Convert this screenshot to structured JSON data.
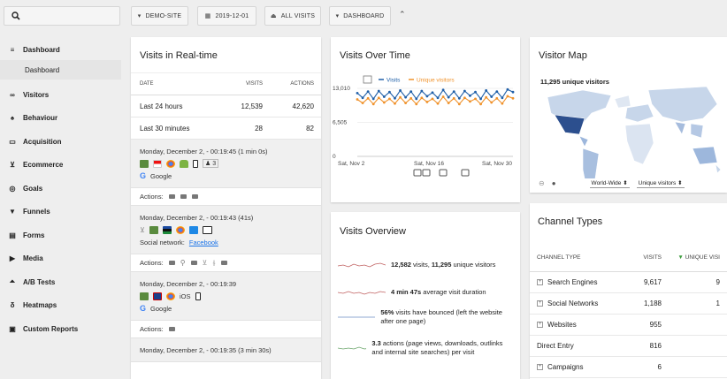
{
  "topbar": {
    "site": "DEMO-SITE",
    "date": "2019-12-01",
    "segment": "ALL VISITS",
    "view": "DASHBOARD"
  },
  "sidebar": {
    "items": [
      {
        "label": "Dashboard",
        "icon": "menu-icon"
      },
      {
        "label": "Visitors",
        "icon": "glasses-icon"
      },
      {
        "label": "Behaviour",
        "icon": "bell-icon"
      },
      {
        "label": "Acquisition",
        "icon": "briefcase-icon"
      },
      {
        "label": "Ecommerce",
        "icon": "cart-icon"
      },
      {
        "label": "Goals",
        "icon": "target-icon"
      },
      {
        "label": "Funnels",
        "icon": "funnel-icon"
      },
      {
        "label": "Forms",
        "icon": "form-icon"
      },
      {
        "label": "Media",
        "icon": "media-icon"
      },
      {
        "label": "A/B Tests",
        "icon": "flask-icon"
      },
      {
        "label": "Heatmaps",
        "icon": "flame-icon"
      },
      {
        "label": "Custom Reports",
        "icon": "report-icon"
      }
    ],
    "sub": "Dashboard"
  },
  "realtime": {
    "title": "Visits in Real-time",
    "headers": [
      "DATE",
      "VISITS",
      "ACTIONS"
    ],
    "rows": [
      {
        "label": "Last 24 hours",
        "visits": "12,539",
        "actions": "42,620"
      },
      {
        "label": "Last 30 minutes",
        "visits": "28",
        "actions": "82"
      }
    ],
    "visits": [
      {
        "time": "Monday, December 2, - 00:19:45 (1 min 0s)",
        "count": "3",
        "source": "Google",
        "actions_label": "Actions:"
      },
      {
        "time": "Monday, December 2, - 00:19:43 (41s)",
        "source_prefix": "Social network:",
        "source": "Facebook",
        "actions_label": "Actions:"
      },
      {
        "time": "Monday, December 2, - 00:19:39",
        "os": "iOS",
        "source": "Google",
        "actions_label": "Actions:"
      },
      {
        "time": "Monday, December 2, - 00:19:35 (3 min 30s)"
      }
    ]
  },
  "vot": {
    "title": "Visits Over Time",
    "legend_visits": "Visits",
    "legend_unique": "Unique visitors",
    "colors": {
      "visits": "#1f5fa8",
      "unique": "#f0922b"
    }
  },
  "chart_data": {
    "type": "line",
    "ylim": [
      0,
      13010
    ],
    "yticks": [
      "13,010",
      "6,505",
      "0"
    ],
    "xticks": [
      "Sat, Nov 2",
      "Sat, Nov 16",
      "Sat, Nov 30"
    ],
    "series": [
      {
        "name": "Visits",
        "values": [
          12100,
          11200,
          12400,
          11000,
          12500,
          11400,
          12300,
          11100,
          12600,
          11300,
          12400,
          11000,
          12500,
          11500,
          12200,
          11200,
          12700,
          11300,
          12400,
          11100,
          12500,
          11600,
          12300,
          11000,
          12600,
          11400,
          12400,
          11200,
          12800,
          12300
        ]
      },
      {
        "name": "Unique visitors",
        "values": [
          10900,
          10200,
          11100,
          10000,
          11200,
          10300,
          11000,
          10100,
          11300,
          10200,
          11100,
          10000,
          11200,
          10400,
          11000,
          10100,
          11400,
          10200,
          11100,
          10000,
          11200,
          10500,
          11000,
          10000,
          11300,
          10300,
          11100,
          10100,
          11500,
          11100
        ]
      }
    ]
  },
  "overview": {
    "title": "Visits Overview",
    "rows": [
      {
        "strong": "12,582",
        "text": " visits, ",
        "strong2": "11,295",
        "text2": " unique visitors"
      },
      {
        "strong": "4 min 47s",
        "text": " average visit duration"
      },
      {
        "strong": "56%",
        "text": " visits have bounced (left the website after one page)"
      },
      {
        "strong": "3.3",
        "text": " actions (page views, downloads, outlinks and internal site searches) per visit"
      }
    ]
  },
  "map": {
    "title": "Visitor Map",
    "label": "11,295 unique visitors",
    "region": "World-Wide",
    "metric": "Unique visitors"
  },
  "channels": {
    "title": "Channel Types",
    "headers": [
      "CHANNEL TYPE",
      "VISITS",
      "UNIQUE VISI"
    ],
    "rows": [
      {
        "label": "Search Engines",
        "visits": "9,617",
        "unique": "9",
        "expand": true
      },
      {
        "label": "Social Networks",
        "visits": "1,188",
        "unique": "1",
        "expand": true
      },
      {
        "label": "Websites",
        "visits": "955",
        "unique": "",
        "expand": true
      },
      {
        "label": "Direct Entry",
        "visits": "816",
        "unique": "",
        "expand": false
      },
      {
        "label": "Campaigns",
        "visits": "6",
        "unique": "",
        "expand": true
      }
    ]
  }
}
